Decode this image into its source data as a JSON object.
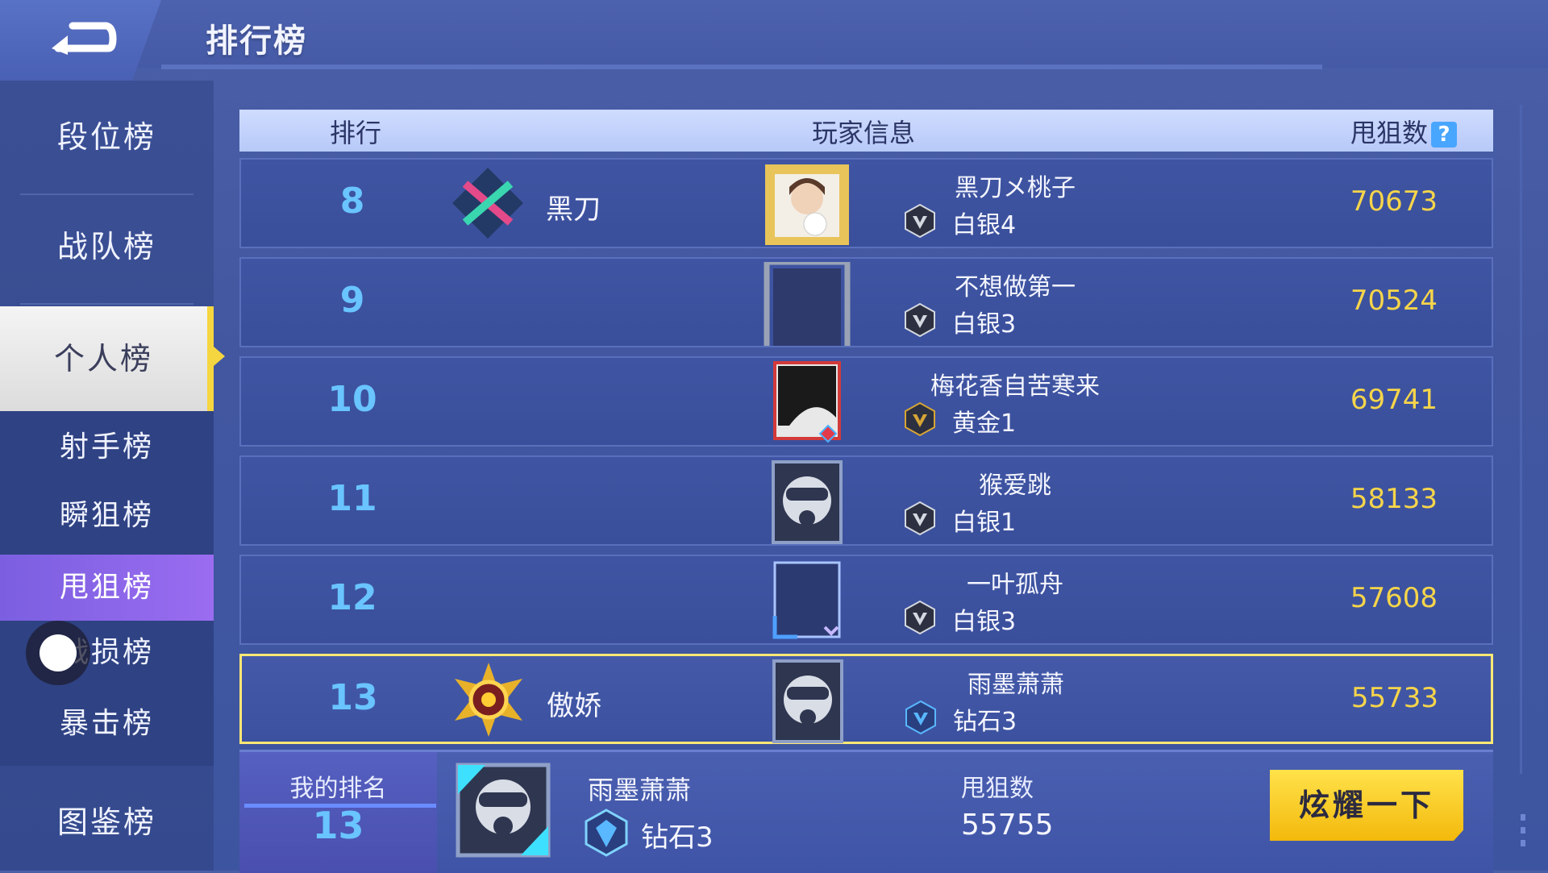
{
  "header": {
    "title": "排行榜"
  },
  "sidebar": {
    "items": [
      {
        "label": "段位榜"
      },
      {
        "label": "战队榜"
      },
      {
        "label": "个人榜"
      },
      {
        "label": "射手榜"
      },
      {
        "label": "瞬狙榜"
      },
      {
        "label": "甩狙榜"
      },
      {
        "label": "战损榜"
      },
      {
        "label": "暴击榜"
      },
      {
        "label": "图鉴榜"
      }
    ],
    "active_category": "个人榜",
    "active_sub": "甩狙榜",
    "partially_hidden_label": "损榜"
  },
  "table": {
    "columns": [
      "排行",
      "玩家信息",
      "甩狙数"
    ],
    "rows": [
      {
        "rank": "8",
        "team": "黑刀",
        "team_icon": "crossed-guns-icon",
        "name": "黑刀メ桃子",
        "tier": "白银4",
        "tier_icon": "silver-badge-icon",
        "avatar": "portrait-gold-frame",
        "score": "70673"
      },
      {
        "rank": "9",
        "team": "",
        "team_icon": "",
        "name": "不想做第一",
        "tier": "白银3",
        "tier_icon": "silver-badge-icon",
        "avatar": "empty-silver-frame",
        "score": "70524"
      },
      {
        "rank": "10",
        "team": "",
        "team_icon": "",
        "name": "梅花香自苦寒来",
        "tier": "黄金1",
        "tier_icon": "gold-badge-icon",
        "avatar": "dark-hair-portrait",
        "score": "69741"
      },
      {
        "rank": "11",
        "team": "",
        "team_icon": "",
        "name": "猴爱跳",
        "tier": "白银1",
        "tier_icon": "silver-badge-icon",
        "avatar": "gas-mask-avatar",
        "score": "58133"
      },
      {
        "rank": "12",
        "team": "",
        "team_icon": "",
        "name": "一叶孤舟",
        "tier": "白银3",
        "tier_icon": "silver-badge-icon",
        "avatar": "empty-blue-frame",
        "score": "57608"
      },
      {
        "rank": "13",
        "team": "傲娇",
        "team_icon": "sun-emblem-icon",
        "name": "雨墨萧萧",
        "tier": "钻石3",
        "tier_icon": "diamond-badge-icon",
        "avatar": "gas-mask-avatar",
        "score": "55733",
        "highlighted": true
      }
    ]
  },
  "footer": {
    "my_rank_label": "我的排名",
    "my_rank": "13",
    "name": "雨墨萧萧",
    "tier": "钻石3",
    "score_label": "甩狙数",
    "score": "55755",
    "show_button": "炫耀一下"
  },
  "colors": {
    "rank_blue": "#69c4ff",
    "score_gold": "#f7d54a",
    "highlight_border": "#ffe874",
    "active_purple": "#8e66ea"
  }
}
